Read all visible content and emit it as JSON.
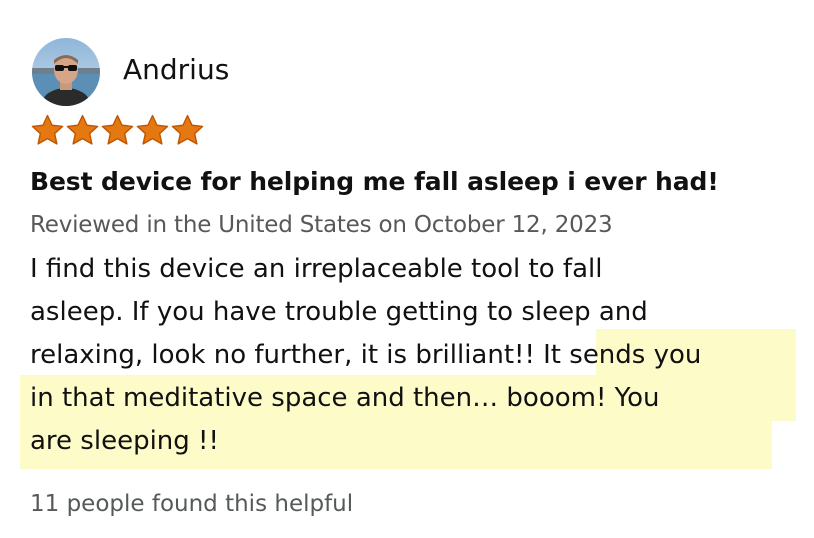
{
  "reviewer": {
    "name": "Andrius",
    "avatar_icon": "profile-photo"
  },
  "rating": {
    "stars": 5,
    "max": 5,
    "color": "#E47911"
  },
  "review": {
    "title": "Best device for helping me fall asleep i ever had!",
    "date_line": "Reviewed in the United States on October 12, 2023",
    "body_lines": [
      "I find this device an irreplaceable tool to fall",
      "asleep. If you have trouble getting to sleep and",
      "relaxing, look no further, it is brilliant!! ",
      "in that meditative space and then… booom! You",
      "are sleeping !!"
    ],
    "highlighted_start": "It sends you",
    "highlight_color": "#FDFBC8"
  },
  "helpful": {
    "text": "11 people found this helpful"
  }
}
